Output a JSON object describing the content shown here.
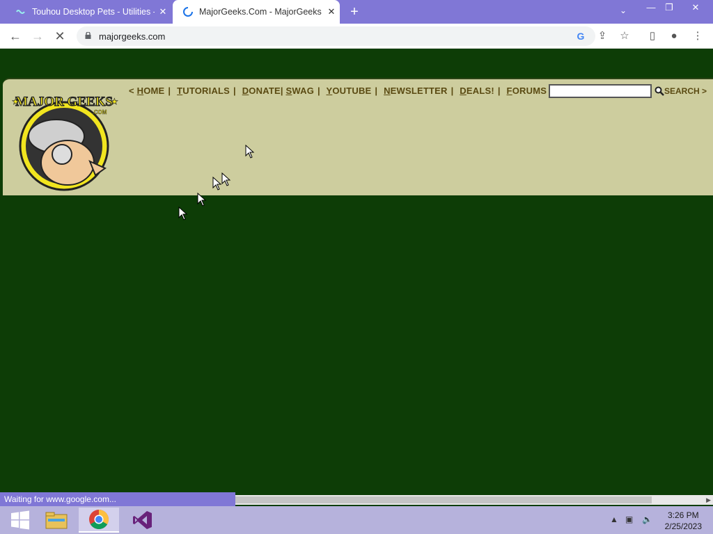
{
  "browser": {
    "tabs": [
      {
        "title": "Touhou Desktop Pets - Utilities -",
        "active": false
      },
      {
        "title": "MajorGeeks.Com - MajorGeeks",
        "active": true
      }
    ],
    "new_tab_icon": "plus-icon",
    "url": "majorgeeks.com",
    "status_text": "Waiting for www.google.com...",
    "accent_color": "#8077d6"
  },
  "site": {
    "logo_text": "MAJOR GEEKS",
    "logo_sub": ".COM",
    "nav_open": "<",
    "nav": [
      {
        "first": "H",
        "rest": "OME"
      },
      {
        "first": "T",
        "rest": "UTORIALS"
      },
      {
        "first": "D",
        "rest": "ONATE"
      },
      {
        "first": "S",
        "rest": "WAG"
      },
      {
        "first": "Y",
        "rest": "OUTUBE"
      },
      {
        "first": "N",
        "rest": "EWSLETTER"
      },
      {
        "first": "D",
        "rest": "EALS!"
      },
      {
        "first": "F",
        "rest": "ORUMS"
      }
    ],
    "search_value": "",
    "search_label": "SEARCH >",
    "header_bg": "#cdcd9e",
    "page_bg": "#0d3d06"
  },
  "taskbar": {
    "apps": [
      "start-button",
      "file-explorer",
      "chrome",
      "visual-studio"
    ],
    "time": "3:26 PM",
    "date": "2/25/2023"
  }
}
